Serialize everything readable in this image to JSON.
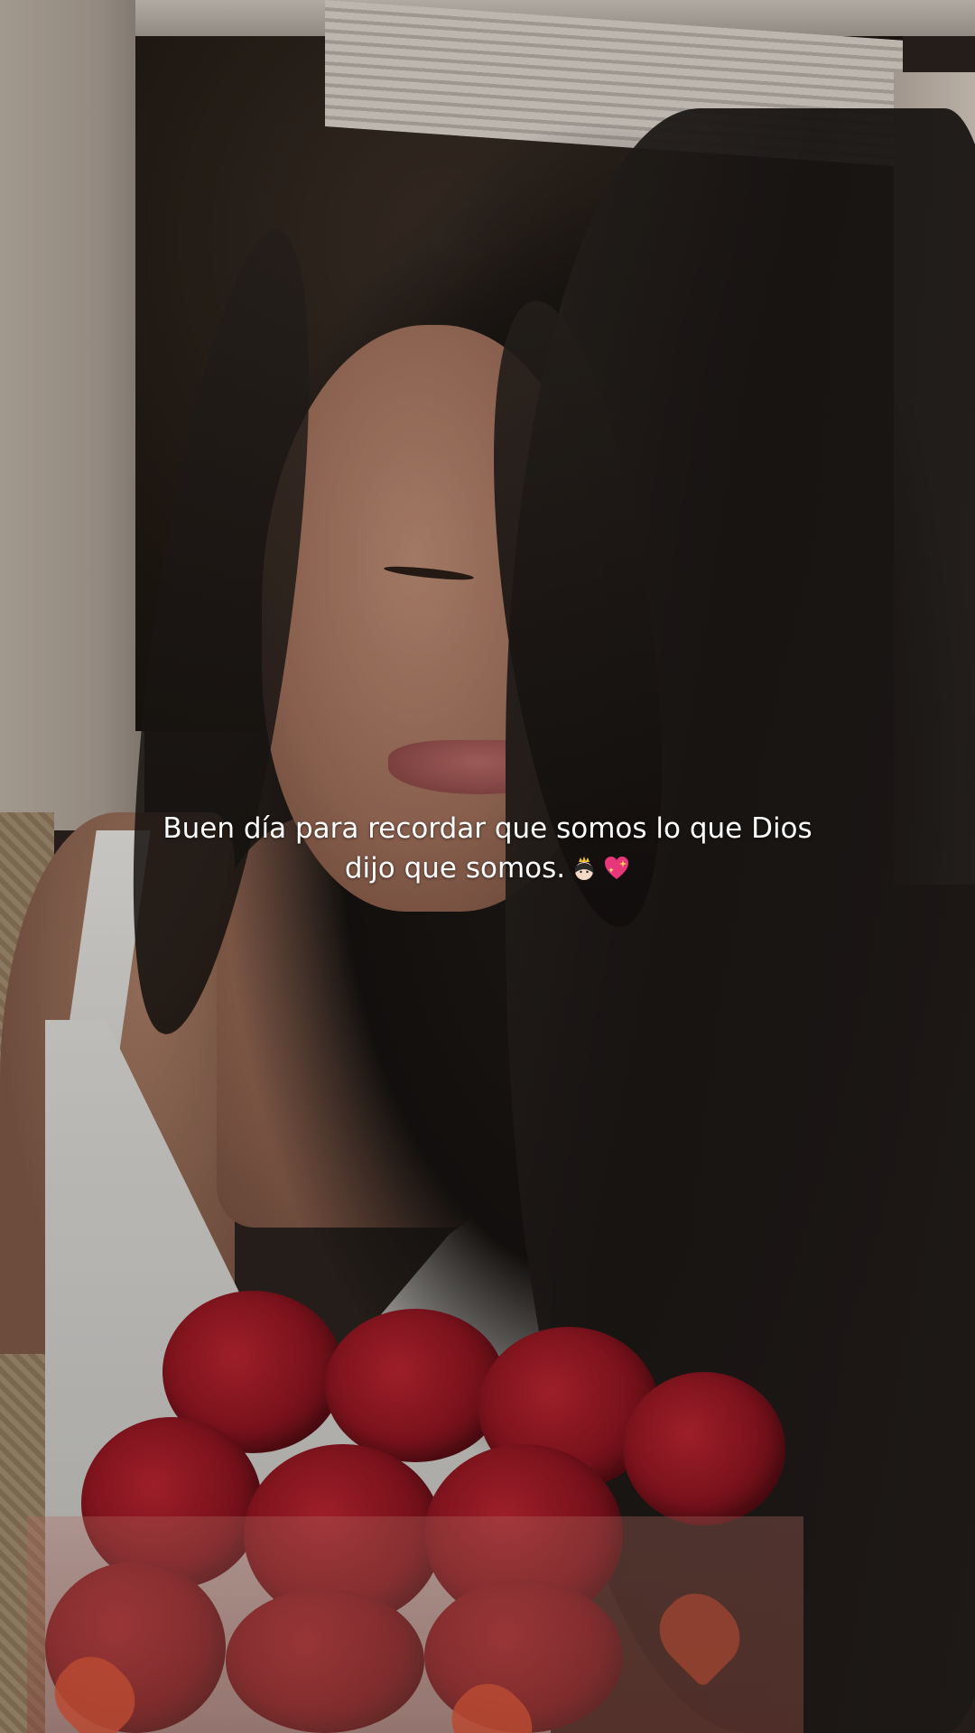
{
  "caption": {
    "line1": "Buen día para recordar que somos lo que Dios",
    "line2": "dijo que somos.",
    "emojis": [
      "princess-emoji",
      "sparkling-heart-emoji"
    ]
  },
  "colors": {
    "caption_text": "#ffffff",
    "rose_red": "#8c1520",
    "hair": "#151210"
  }
}
